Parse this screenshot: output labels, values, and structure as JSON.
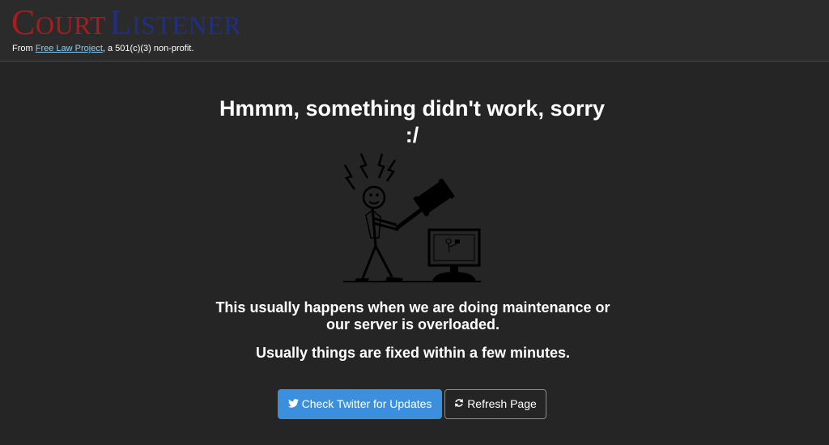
{
  "header": {
    "logo_court_initial": "C",
    "logo_court_rest": "OURT",
    "logo_listener_initial": "L",
    "logo_listener_rest": "ISTENER",
    "tagline_prefix": "From ",
    "tagline_link": "Free Law Project",
    "tagline_suffix": ", a 501(c)(3) non-profit.",
    "colors": {
      "court": "#a81c1f",
      "listener": "#1f2f86",
      "link": "#8ecdf5"
    }
  },
  "main": {
    "title": "Hmmm, something didn't work, sorry :/",
    "illustration_icon": "frustrated-stick-figure-smashing-computer-with-gavel",
    "message_1": "This usually happens when we are doing maintenance or our server is overloaded.",
    "message_2": "Usually things are fixed within a few minutes."
  },
  "buttons": {
    "twitter_label": "Check Twitter for Updates",
    "twitter_icon": "twitter-bird-icon",
    "twitter_color": "#3c8fdd",
    "refresh_label": "Refresh Page",
    "refresh_icon": "refresh-icon"
  }
}
